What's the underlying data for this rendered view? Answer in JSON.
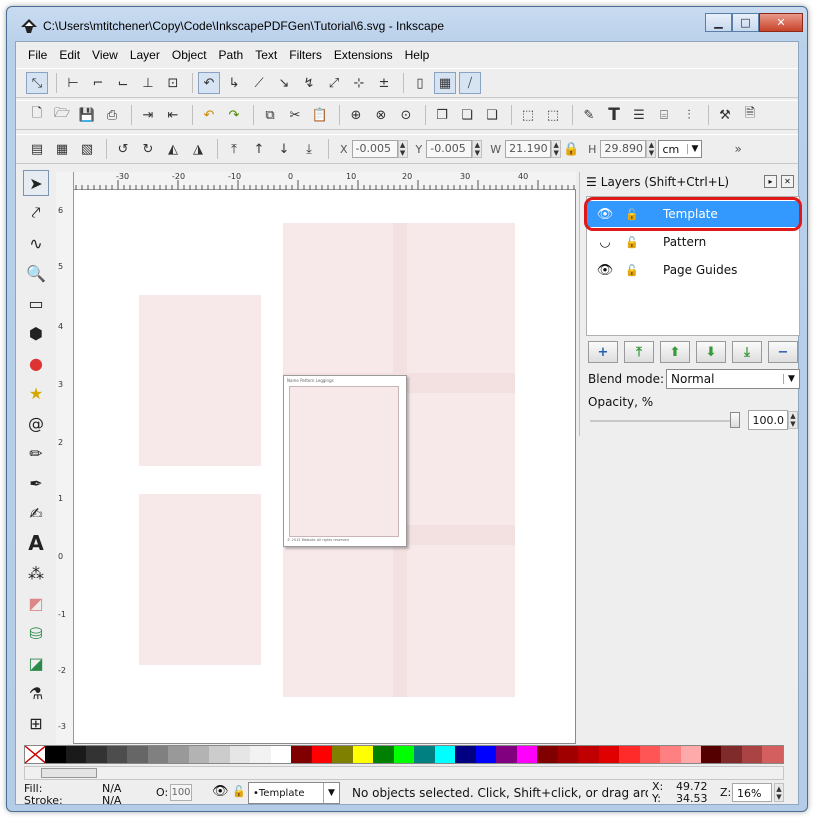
{
  "window": {
    "title": "C:\\Users\\mtitchener\\Copy\\Code\\InkscapePDFGen\\Tutorial\\6.svg - Inkscape",
    "minimize": "▁",
    "maximize": "□",
    "close": "✕"
  },
  "menu": [
    "File",
    "Edit",
    "View",
    "Layer",
    "Object",
    "Path",
    "Text",
    "Filters",
    "Extensions",
    "Help"
  ],
  "controls": {
    "x_label": "X",
    "x_value": "-0.005",
    "y_label": "Y",
    "y_value": "-0.005",
    "w_label": "W",
    "w_value": "21.190",
    "h_label": "H",
    "h_value": "29.890",
    "unit": "cm",
    "more": "»"
  },
  "ruler": {
    "h": [
      "-30",
      "-20",
      "-10",
      "0",
      "10",
      "20",
      "30",
      "40"
    ],
    "v": [
      "6",
      "5",
      "4",
      "3",
      "2",
      "1",
      "0",
      "-1",
      "-2",
      "-3"
    ]
  },
  "page_preview": {
    "header_text": "Name Pattern Leggings",
    "footer_text": "© 2015 Website All rights reserved"
  },
  "layers_panel": {
    "title": "Layers (Shift+Ctrl+L)",
    "layers": [
      {
        "name": "Template",
        "selected": true
      },
      {
        "name": "Pattern",
        "selected": false
      },
      {
        "name": "Page Guides",
        "selected": false
      }
    ],
    "blend_label": "Blend mode:",
    "blend_value": "Normal",
    "opacity_label": "Opacity, %",
    "opacity_value": "100.0",
    "opacity_level": 1.0
  },
  "palette": [
    "#000000",
    "#1a1a1a",
    "#333333",
    "#4d4d4d",
    "#666666",
    "#808080",
    "#999999",
    "#b3b3b3",
    "#cccccc",
    "#e6e6e6",
    "#f2f2f2",
    "#ffffff",
    "#800000",
    "#ff0000",
    "#808000",
    "#ffff00",
    "#008000",
    "#00ff00",
    "#008080",
    "#00ffff",
    "#000080",
    "#0000ff",
    "#800080",
    "#ff00ff",
    "#800000",
    "#a00000",
    "#c00000",
    "#e00000",
    "#ff2a2a",
    "#ff5555",
    "#ff8080",
    "#ffaaaa",
    "#550000",
    "#802b2b",
    "#aa4444",
    "#d35f5f"
  ],
  "status": {
    "fill_label": "Fill:",
    "fill_value": "N/A",
    "stroke_label": "Stroke:",
    "stroke_value": "N/A",
    "opacity_label": "O:",
    "opacity_value": "100",
    "current_layer": "•Template",
    "message": "No objects selected. Click, Shift+click, or drag around o...",
    "x_label": "X:",
    "x_value": "49.72",
    "y_label": "Y:",
    "y_value": "34.53",
    "z_label": "Z:",
    "zoom": "16%"
  }
}
